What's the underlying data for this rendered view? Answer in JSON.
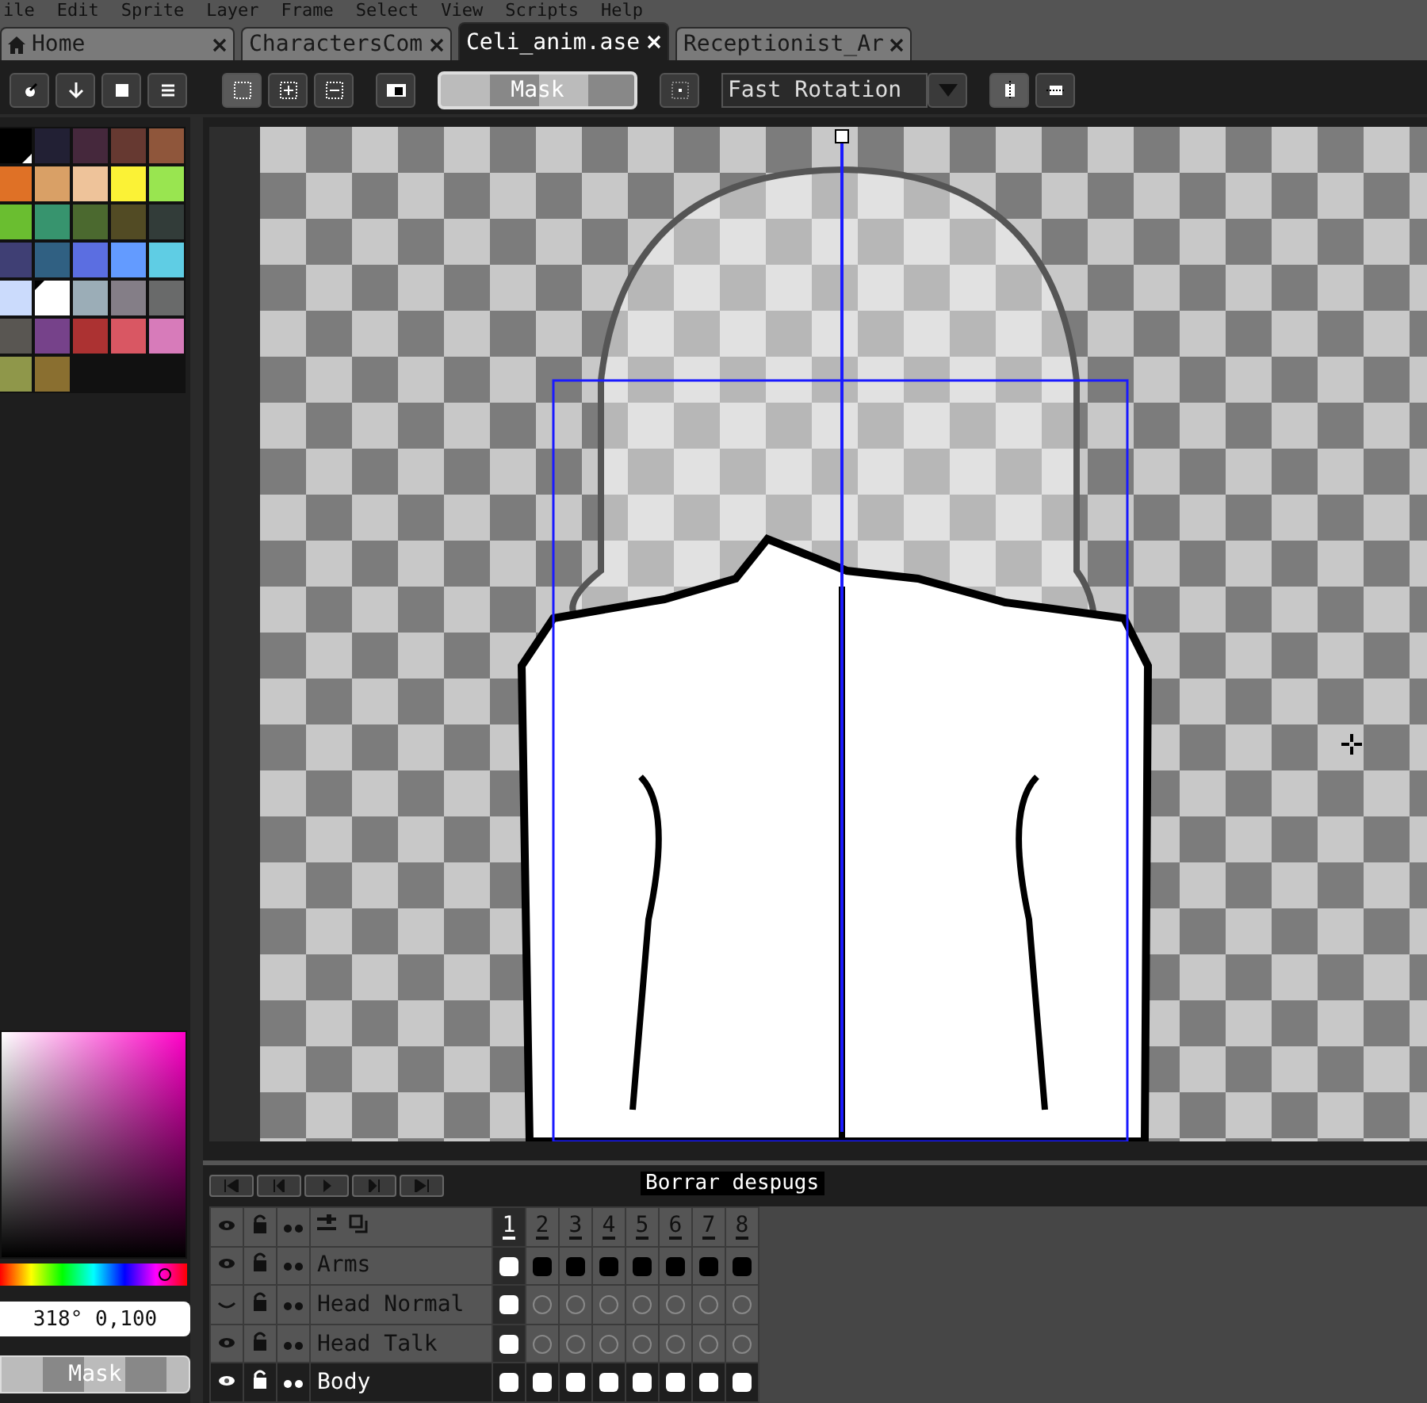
{
  "menu": [
    "ile",
    "Edit",
    "Sprite",
    "Layer",
    "Frame",
    "Select",
    "View",
    "Scripts",
    "Help"
  ],
  "tabs": [
    {
      "label": "Home",
      "kind": "home",
      "selected": false
    },
    {
      "label": "CharactersCom",
      "kind": "file",
      "selected": false
    },
    {
      "label": "Celi_anim.ase",
      "kind": "file",
      "selected": true
    },
    {
      "label": "Receptionist_Ar",
      "kind": "file",
      "selected": false
    }
  ],
  "toolbar": {
    "mask_button": "Mask",
    "rotation_dropdown": "Fast Rotation"
  },
  "palette": [
    {
      "color": "#000000",
      "selected": true
    },
    {
      "color": "#222034",
      "selected": false
    },
    {
      "color": "#45283c",
      "selected": false
    },
    {
      "color": "#663931",
      "selected": false
    },
    {
      "color": "#8f563b",
      "selected": false
    },
    {
      "color": "#df7126",
      "selected": false
    },
    {
      "color": "#d9a066",
      "selected": false
    },
    {
      "color": "#eec39a",
      "selected": false
    },
    {
      "color": "#fbf236",
      "selected": false
    },
    {
      "color": "#99e550",
      "selected": false
    },
    {
      "color": "#6abe30",
      "selected": false
    },
    {
      "color": "#37946e",
      "selected": false
    },
    {
      "color": "#4b692f",
      "selected": false
    },
    {
      "color": "#524b24",
      "selected": false
    },
    {
      "color": "#323c39",
      "selected": false
    },
    {
      "color": "#3f3f74",
      "selected": false
    },
    {
      "color": "#306082",
      "selected": false
    },
    {
      "color": "#5b6ee1",
      "selected": false
    },
    {
      "color": "#639bff",
      "selected": false
    },
    {
      "color": "#5fcde4",
      "selected": false
    },
    {
      "color": "#cbdbfc",
      "selected": false
    },
    {
      "color": "#ffffff",
      "selected": true
    },
    {
      "color": "#9badb7",
      "selected": false
    },
    {
      "color": "#847e87",
      "selected": false
    },
    {
      "color": "#696a6a",
      "selected": false
    },
    {
      "color": "#595652",
      "selected": false
    },
    {
      "color": "#76428a",
      "selected": false
    },
    {
      "color": "#ac3232",
      "selected": false
    },
    {
      "color": "#d95763",
      "selected": false
    },
    {
      "color": "#d77bba",
      "selected": false
    },
    {
      "color": "#8f974a",
      "selected": false
    },
    {
      "color": "#8a6f30",
      "selected": false
    }
  ],
  "color_picker": {
    "value": "318° 0,100",
    "hue": {
      "level": 0.88
    }
  },
  "sidebar_mask_button": "Mask",
  "timeline": {
    "tooltip": "Borrar despugs",
    "frames": [
      {
        "label": "1",
        "selected": true
      },
      {
        "label": "2",
        "selected": false
      },
      {
        "label": "3",
        "selected": false
      },
      {
        "label": "4",
        "selected": false
      },
      {
        "label": "5",
        "selected": false
      },
      {
        "label": "6",
        "selected": false
      },
      {
        "label": "7",
        "selected": false
      },
      {
        "label": "8",
        "selected": false
      }
    ],
    "layers": [
      {
        "name": "Arms",
        "visible": true,
        "selected": false,
        "cels": [
          {
            "filled": true
          },
          {
            "filled": true
          },
          {
            "filled": true
          },
          {
            "filled": true
          },
          {
            "filled": true
          },
          {
            "filled": true
          },
          {
            "filled": true
          },
          {
            "filled": true
          }
        ]
      },
      {
        "name": "Head Normal",
        "visible": false,
        "selected": false,
        "cels": [
          {
            "filled": true
          },
          {
            "filled": false
          },
          {
            "filled": false
          },
          {
            "filled": false
          },
          {
            "filled": false
          },
          {
            "filled": false
          },
          {
            "filled": false
          },
          {
            "filled": false
          }
        ]
      },
      {
        "name": "Head Talk",
        "visible": true,
        "selected": false,
        "cels": [
          {
            "filled": true
          },
          {
            "filled": false
          },
          {
            "filled": false
          },
          {
            "filled": false
          },
          {
            "filled": false
          },
          {
            "filled": false
          },
          {
            "filled": false
          },
          {
            "filled": false
          }
        ]
      },
      {
        "name": "Body",
        "visible": true,
        "selected": true,
        "cels": [
          {
            "filled": true
          },
          {
            "filled": true
          },
          {
            "filled": true
          },
          {
            "filled": true
          },
          {
            "filled": true
          },
          {
            "filled": true
          },
          {
            "filled": true
          },
          {
            "filled": true
          }
        ]
      }
    ]
  }
}
